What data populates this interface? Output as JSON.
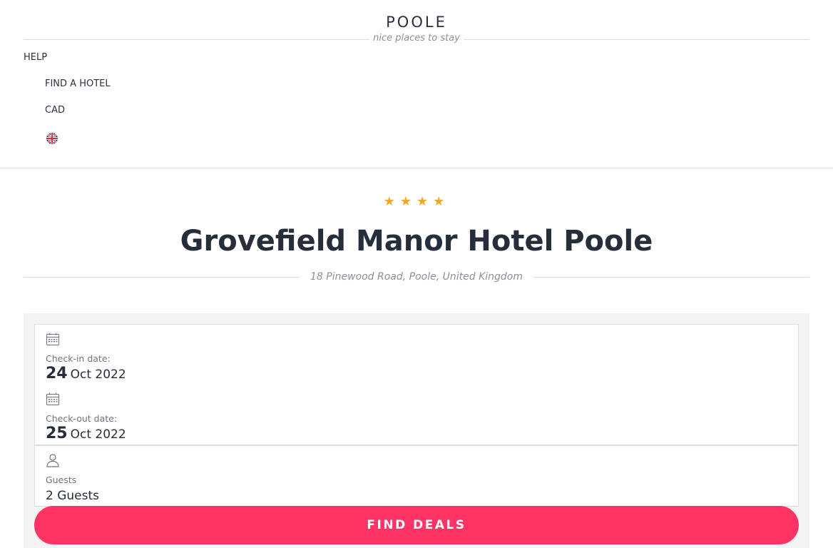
{
  "brand": {
    "name": "POOLE",
    "tagline": "nice places to stay"
  },
  "nav": {
    "help": "HELP",
    "find_hotel": "FIND A HOTEL",
    "currency": "CAD",
    "language_icon": "uk-flag-icon"
  },
  "hotel": {
    "rating": 4,
    "stars": [
      "★",
      "★",
      "★",
      "★"
    ],
    "name": "Grovefield Manor Hotel Poole",
    "address": "18 Pinewood Road, Poole, United Kingdom"
  },
  "search": {
    "checkin": {
      "icon": "calendar-icon",
      "label": "Check-in date:",
      "day": "24",
      "month_year": "Oct 2022"
    },
    "checkout": {
      "icon": "calendar-icon",
      "label": "Check-out date:",
      "day": "25",
      "month_year": "Oct 2022"
    },
    "guests": {
      "icon": "person-icon",
      "label": "Guests",
      "value": "2 Guests"
    },
    "button_label": "FIND DEALS"
  },
  "colors": {
    "accent": "#ff3366",
    "star": "#f5a623",
    "text": "#2b3140",
    "panel": "#f3f3f3"
  }
}
